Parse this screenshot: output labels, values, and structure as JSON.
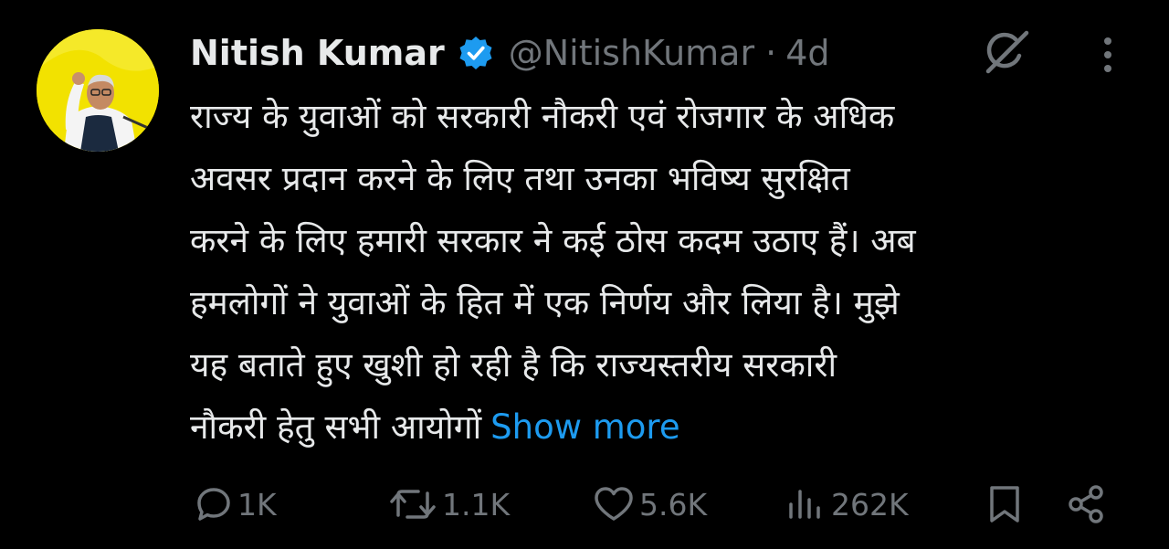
{
  "tweet": {
    "author_name": "Nitish Kumar",
    "handle": "@NitishKumar",
    "separator": "·",
    "time": "4d",
    "text_lines": [
      "राज्य के युवाओं को सरकारी नौकरी एवं रोजगार के अधिक",
      "अवसर प्रदान करने के लिए तथा उनका भविष्य सुरक्षित",
      "करने के लिए हमारी सरकार ने कई ठोस कदम उठाए हैं। अब",
      "हमलोगों ने युवाओं के हित में एक निर्णय और लिया है। मुझे",
      "यह बताते हुए खुशी हो रही है कि राज्यस्तरीय सरकारी",
      "नौकरी हेतु सभी आयोगों"
    ],
    "show_more_label": "Show more"
  },
  "actions": {
    "replies": "1K",
    "reposts": "1.1K",
    "likes": "5.6K",
    "views": "262K"
  },
  "icons": {
    "verified": "verified-badge-icon",
    "grok": "grok-icon",
    "more": "more-vertical-icon",
    "reply": "reply-icon",
    "repost": "repost-icon",
    "like": "heart-icon",
    "views": "views-icon",
    "bookmark": "bookmark-icon",
    "share": "share-icon"
  },
  "colors": {
    "background": "#000000",
    "text": "#e7e9ea",
    "secondary": "#71767b",
    "accent": "#1d9bf0",
    "avatar_bg": "#f2e200"
  }
}
